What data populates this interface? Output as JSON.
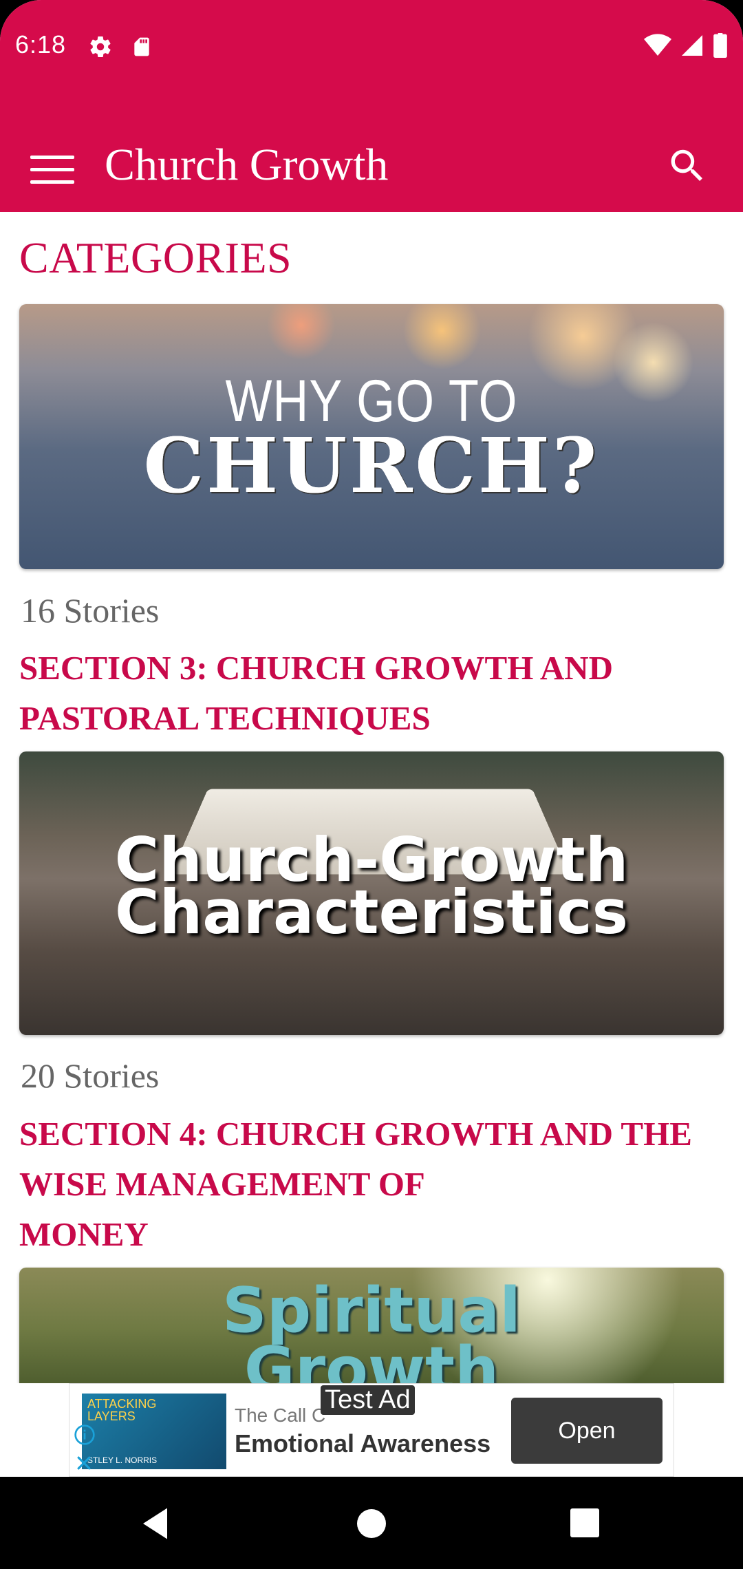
{
  "status_bar": {
    "time": "6:18",
    "icons": [
      "settings-icon",
      "sd-card-icon",
      "wifi-icon",
      "signal-icon",
      "battery-icon"
    ]
  },
  "app_bar": {
    "title": "Church Growth",
    "menu_icon": "hamburger-menu-icon",
    "search_icon": "search-icon"
  },
  "main": {
    "heading": "CATEGORIES",
    "cards": [
      {
        "image_text_line1": "WHY GO TO",
        "image_text_line2": "CHURCH?",
        "stories": "16 Stories",
        "title": "SECTION 3: CHURCH GROWTH AND\nPASTORAL TECHNIQUES"
      },
      {
        "image_text_line1": "Church-Growth",
        "image_text_line2": "Characteristics",
        "stories": "20 Stories",
        "title": "SECTION 4: CHURCH GROWTH AND THE\nWISE MANAGEMENT OF\nMONEY"
      },
      {
        "image_text_line1": "Spiritual",
        "image_text_line2": "Growth"
      }
    ]
  },
  "ad": {
    "label": "Test Ad",
    "thumb_text": "ATTACKING\nLAYERS",
    "thumb_author": "STLEY L. NORRIS",
    "source": "The Call C",
    "headline": "Emotional Awareness",
    "button": "Open"
  },
  "colors": {
    "primary": "#d50b4b",
    "accent_text": "#c8094a"
  }
}
